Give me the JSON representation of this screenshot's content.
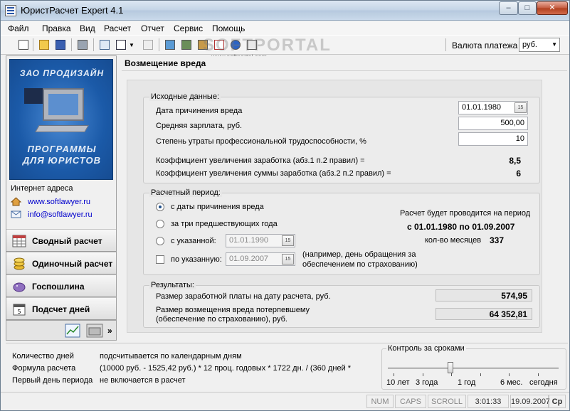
{
  "window": {
    "title": "ЮристРасчет Expert 4.1",
    "min": "–",
    "max": "□",
    "close": "✕"
  },
  "menu": [
    "Файл",
    "Правка",
    "Вид",
    "Расчет",
    "Отчет",
    "Сервис",
    "Помощь"
  ],
  "watermark": {
    "text": "SOFTPORTAL",
    "url": "www.softportal.com"
  },
  "toolbar": {
    "currency_label": "Валюта платежа",
    "currency_value": "руб."
  },
  "left": {
    "banner_top": "ЗАО ПРОДИЗАЙН",
    "banner_bottom_1": "ПРОГРАММЫ",
    "banner_bottom_2": "ДЛЯ ЮРИСТОВ",
    "links_title": "Интернет адреса",
    "site": "www.softlawyer.ru",
    "email": "info@softlawyer.ru",
    "nav": [
      "Сводный расчет",
      "Одиночный расчет",
      "Госпошлина",
      "Подсчет дней"
    ],
    "more": "»"
  },
  "main": {
    "header": "Возмещение вреда",
    "input": {
      "title": "Исходные данные:",
      "date_label": "Дата причинения вреда",
      "date_value": "01.01.1980",
      "salary_label": "Средняя зарплата, руб.",
      "salary_value": "500,00",
      "loss_label": "Степень утраты профессиональной трудоспособности, %",
      "loss_value": "10",
      "coef1_label": "Коэффициент увеличения заработка (абз.1 п.2 правил) =",
      "coef1_value": "8,5",
      "coef2_label": "Коэффициент увеличения суммы заработка (абз.2 п.2 правил) =",
      "coef2_value": "6"
    },
    "period": {
      "title": "Расчетный период:",
      "opt1": "с даты причинения вреда",
      "opt2": "за три предшествующих года",
      "opt3": "с указанной:",
      "opt3_date": "01.01.1990",
      "opt4": "по указанную:",
      "opt4_date": "01.09.2007",
      "note": "(например, день обращения за обеспечением по страхованию)",
      "info_title": "Расчет будет проводится на период",
      "info_range": "с 01.01.1980  по 01.09.2007",
      "months_label": "кол-во месяцев",
      "months_value": "337"
    },
    "results": {
      "title": "Результаты:",
      "r1_label": "Размер заработной платы на дату расчета, руб.",
      "r1_value": "574,95",
      "r2_label_1": "Размер возмещения вреда потерпевшему",
      "r2_label_2": "(обеспечение по страхованию), руб.",
      "r2_value": "64 352,81"
    }
  },
  "bottom": {
    "days_label": "Количество дней",
    "days_value": "подсчитывается по календарным дням",
    "formula_label": "Формула расчета",
    "formula_value": "(10000 руб. - 1525,42 руб.) * 12 проц. годовых * 1722 дн. / (360 дней * ",
    "first_label": "Первый день периода",
    "first_value": "не включается в расчет",
    "control_title": "Контроль за сроками",
    "ticks": [
      "10 лет",
      "3 года",
      "1 год",
      "6 мес.",
      "сегодня"
    ]
  },
  "status": {
    "num": "NUM",
    "caps": "CAPS",
    "scroll": "SCROLL",
    "time": "3:01:33",
    "date": "19.09.2007",
    "extra": "Ср"
  }
}
